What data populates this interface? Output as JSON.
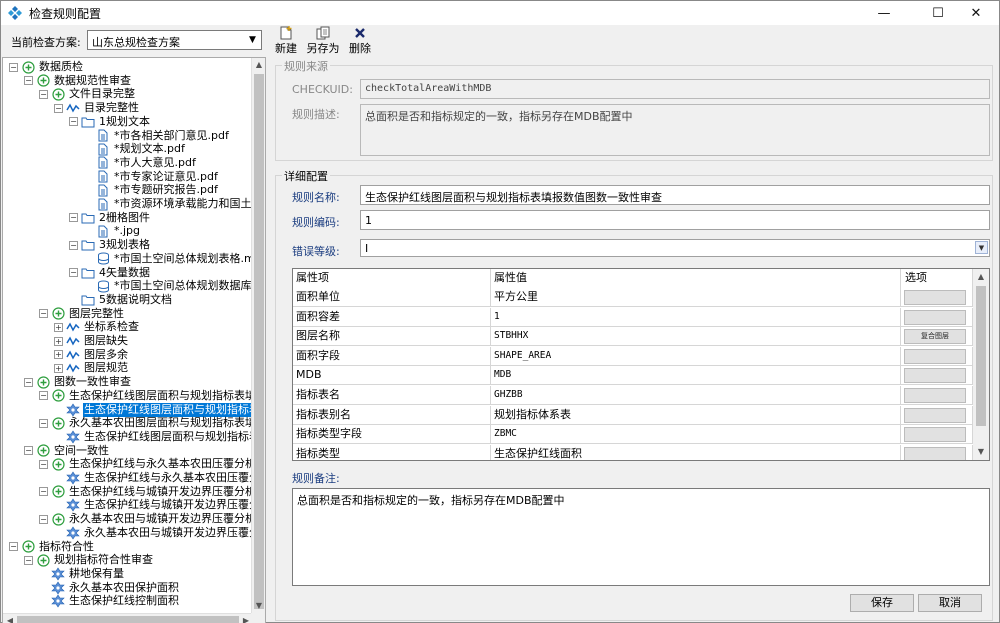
{
  "window": {
    "title": "检查规则配置",
    "min": "—",
    "max": "☐",
    "close": "✕"
  },
  "plan": {
    "label": "当前检查方案:",
    "value": "山东总规检查方案"
  },
  "toolbar": {
    "new_label": "新建",
    "saveas_label": "另存为",
    "delete_label": "删除"
  },
  "source": {
    "title": "规则来源",
    "checkuid_label": "CHECKUID:",
    "checkuid_value": "checkTotalAreaWithMDB",
    "desc_label": "规则描述:",
    "desc_value": "总面积是否和指标规定的一致，指标另存在MDB配置中"
  },
  "detail": {
    "title": "详细配置",
    "name_label": "规则名称:",
    "name_value": "生态保护红线图层面积与规划指标表填报数值图数一致性审查",
    "code_label": "规则编码:",
    "code_value": "1",
    "level_label": "错误等级:",
    "level_value": "I",
    "grid_headers": [
      "属性项",
      "属性值",
      "选项"
    ],
    "grid_rows": [
      {
        "k": "面积单位",
        "v": "平方公里",
        "opt": ""
      },
      {
        "k": "面积容差",
        "v": "1",
        "opt": ""
      },
      {
        "k": "图层名称",
        "v": "STBHHX",
        "opt": "复合图层"
      },
      {
        "k": "面积字段",
        "v": "SHAPE_AREA",
        "opt": ""
      },
      {
        "k": "MDB",
        "v": "MDB",
        "opt": ""
      },
      {
        "k": "指标表名",
        "v": "GHZBB",
        "opt": ""
      },
      {
        "k": "指标表别名",
        "v": "规划指标体系表",
        "opt": ""
      },
      {
        "k": "指标类型字段",
        "v": "ZBMC",
        "opt": ""
      },
      {
        "k": "指标类型",
        "v": "生态保护红线面积",
        "opt": ""
      }
    ],
    "remark_label": "规则备注:",
    "remark_value": "总面积是否和指标规定的一致，指标另存在MDB配置中",
    "save_label": "保存",
    "cancel_label": "取消"
  },
  "tree": [
    {
      "label": "数据质检",
      "depth": 0,
      "exp": "−",
      "icon": "plus-circle"
    },
    {
      "label": "数据规范性审查",
      "depth": 1,
      "exp": "−",
      "icon": "plus-circle"
    },
    {
      "label": "文件目录完整",
      "depth": 2,
      "exp": "−",
      "icon": "plus-circle"
    },
    {
      "label": "目录完整性",
      "depth": 3,
      "exp": "−",
      "icon": "wave"
    },
    {
      "label": "1规划文本",
      "depth": 4,
      "exp": "−",
      "icon": "folder"
    },
    {
      "label": "*市各相关部门意见.pdf",
      "depth": 5,
      "exp": "",
      "icon": "doc"
    },
    {
      "label": "*规划文本.pdf",
      "depth": 5,
      "exp": "",
      "icon": "doc"
    },
    {
      "label": "*市人大意见.pdf",
      "depth": 5,
      "exp": "",
      "icon": "doc"
    },
    {
      "label": "*市专家论证意见.pdf",
      "depth": 5,
      "exp": "",
      "icon": "doc"
    },
    {
      "label": "*市专题研究报告.pdf",
      "depth": 5,
      "exp": "",
      "icon": "doc"
    },
    {
      "label": "*市资源环境承载能力和国土",
      "depth": 5,
      "exp": "",
      "icon": "doc"
    },
    {
      "label": "2栅格图件",
      "depth": 4,
      "exp": "−",
      "icon": "folder"
    },
    {
      "label": "*.jpg",
      "depth": 5,
      "exp": "",
      "icon": "doc"
    },
    {
      "label": "3规划表格",
      "depth": 4,
      "exp": "−",
      "icon": "folder"
    },
    {
      "label": "*市国土空间总体规划表格.m",
      "depth": 5,
      "exp": "",
      "icon": "db"
    },
    {
      "label": "4矢量数据",
      "depth": 4,
      "exp": "−",
      "icon": "folder"
    },
    {
      "label": "*市国土空间总体规划数据库",
      "depth": 5,
      "exp": "",
      "icon": "db"
    },
    {
      "label": "5数据说明文档",
      "depth": 4,
      "exp": "",
      "icon": "folder"
    },
    {
      "label": "图层完整性",
      "depth": 2,
      "exp": "−",
      "icon": "plus-circle"
    },
    {
      "label": "坐标系检查",
      "depth": 3,
      "exp": "+",
      "icon": "wave"
    },
    {
      "label": "图层缺失",
      "depth": 3,
      "exp": "+",
      "icon": "wave"
    },
    {
      "label": "图层多余",
      "depth": 3,
      "exp": "+",
      "icon": "wave"
    },
    {
      "label": "图层规范",
      "depth": 3,
      "exp": "+",
      "icon": "wave"
    },
    {
      "label": "图数一致性审查",
      "depth": 1,
      "exp": "−",
      "icon": "plus-circle"
    },
    {
      "label": "生态保护红线图层面积与规划指标表填:",
      "depth": 2,
      "exp": "−",
      "icon": "plus-circle"
    },
    {
      "label": "生态保护红线图层面积与规划指标表",
      "depth": 3,
      "exp": "",
      "icon": "gear",
      "selected": true
    },
    {
      "label": "永久基本农田图层面积与规划指标表填:",
      "depth": 2,
      "exp": "−",
      "icon": "plus-circle"
    },
    {
      "label": "生态保护红线图层面积与规划指标表",
      "depth": 3,
      "exp": "",
      "icon": "gear"
    },
    {
      "label": "空间一致性",
      "depth": 1,
      "exp": "−",
      "icon": "plus-circle"
    },
    {
      "label": "生态保护红线与永久基本农田压覆分析",
      "depth": 2,
      "exp": "−",
      "icon": "plus-circle"
    },
    {
      "label": "生态保护红线与永久基本农田压覆分",
      "depth": 3,
      "exp": "",
      "icon": "gear"
    },
    {
      "label": "生态保护红线与城镇开发边界压覆分析",
      "depth": 2,
      "exp": "−",
      "icon": "plus-circle"
    },
    {
      "label": "生态保护红线与城镇开发边界压覆分",
      "depth": 3,
      "exp": "",
      "icon": "gear"
    },
    {
      "label": "永久基本农田与城镇开发边界压覆分析",
      "depth": 2,
      "exp": "−",
      "icon": "plus-circle"
    },
    {
      "label": "永久基本农田与城镇开发边界压覆分",
      "depth": 3,
      "exp": "",
      "icon": "gear"
    },
    {
      "label": "指标符合性",
      "depth": 0,
      "exp": "−",
      "icon": "plus-circle"
    },
    {
      "label": "规划指标符合性审查",
      "depth": 1,
      "exp": "−",
      "icon": "plus-circle"
    },
    {
      "label": "耕地保有量",
      "depth": 2,
      "exp": "",
      "icon": "gear"
    },
    {
      "label": "永久基本农田保护面积",
      "depth": 2,
      "exp": "",
      "icon": "gear"
    },
    {
      "label": "生态保护红线控制面积",
      "depth": 2,
      "exp": "",
      "icon": "gear"
    }
  ],
  "colors": {
    "accent": "#0078d7",
    "label_blue": "#1b3d80",
    "icon_green": "#2e9e3e",
    "icon_blue": "#1565c0"
  }
}
